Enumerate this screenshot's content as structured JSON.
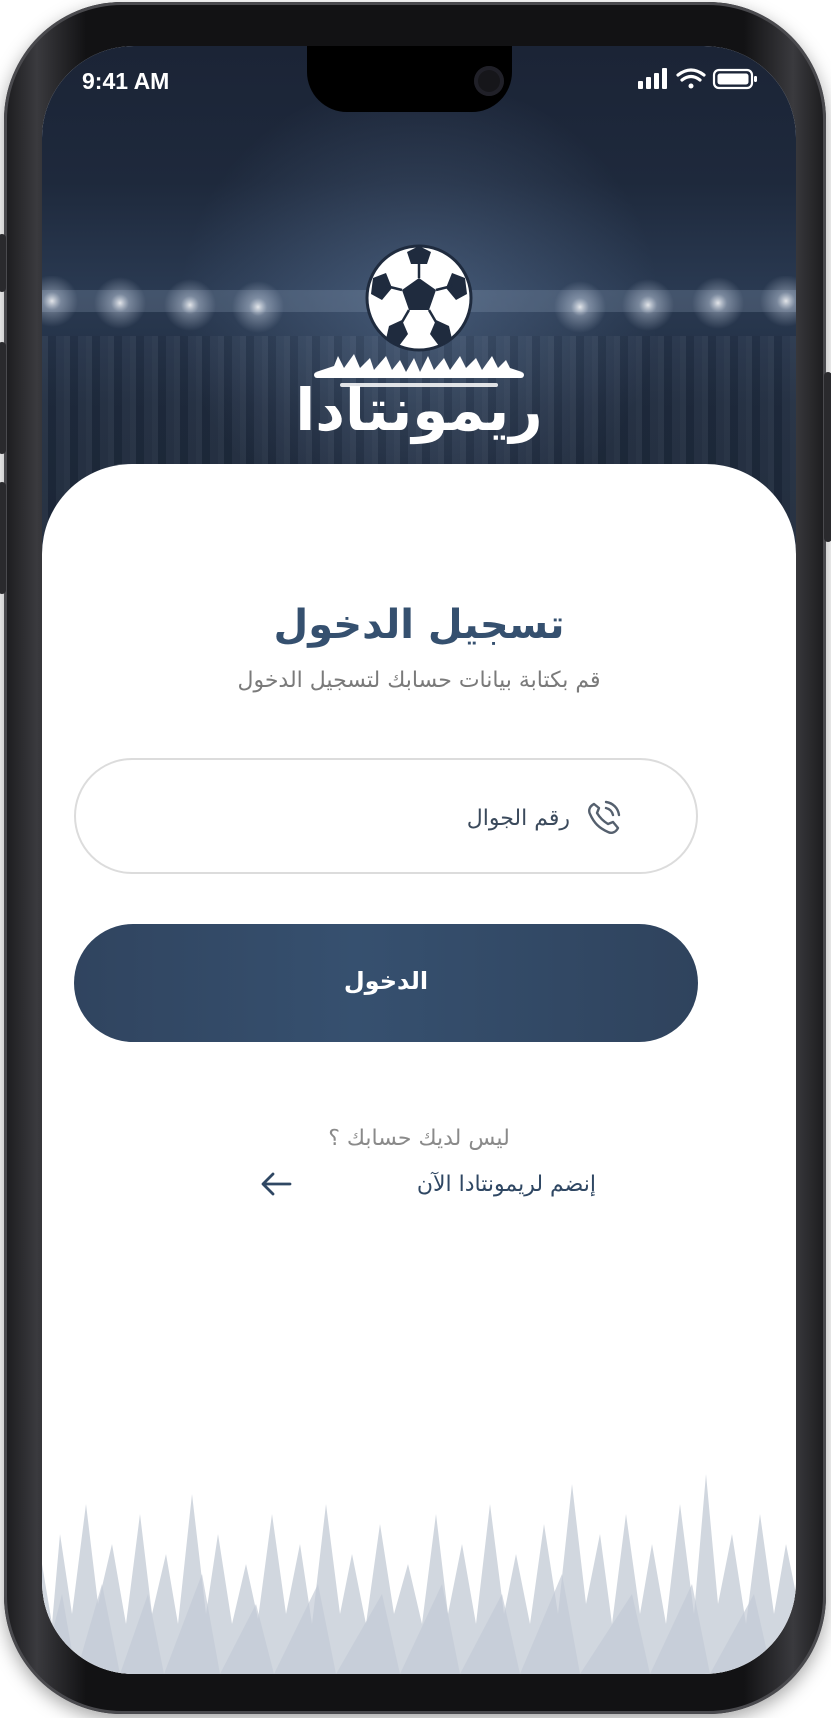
{
  "status_bar": {
    "time": "9:41 AM"
  },
  "logo": {
    "text": "ريمونتادا"
  },
  "login": {
    "title": "تسجيل الدخول",
    "subtitle": "قم بكتابة بيانات حسابك لتسجيل الدخول",
    "phone_placeholder": "رقم الجوال",
    "submit_label": "الدخول",
    "no_account_text": "ليس لديك حسابك ؟",
    "join_link_text": "إنضم لريمونتادا الآن"
  },
  "icons": {
    "phone_field": "phone-icon",
    "join_link": "arrow-left-icon",
    "status": [
      "signal-icon",
      "wifi-icon",
      "battery-icon"
    ],
    "logo": "soccer-ball-icon"
  },
  "colors": {
    "primary": "#35506f",
    "button": "#34496a",
    "hero_bg": "#1e293c",
    "grass": "#d1d7df"
  }
}
